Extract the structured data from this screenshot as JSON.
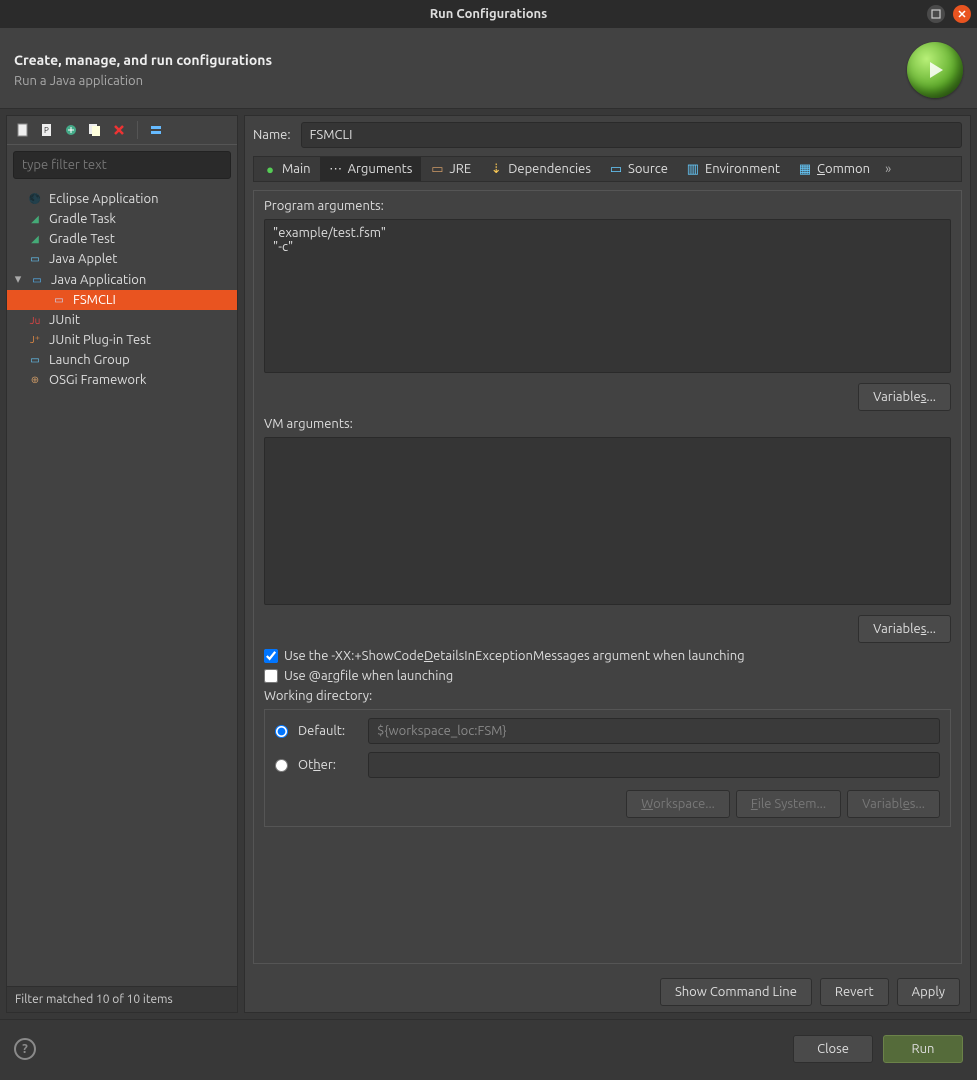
{
  "window": {
    "title": "Run Configurations"
  },
  "header": {
    "title": "Create, manage, and run configurations",
    "subtitle": "Run a Java application"
  },
  "sidebar": {
    "filter_placeholder": "type filter text",
    "items": [
      {
        "label": "Eclipse Application"
      },
      {
        "label": "Gradle Task"
      },
      {
        "label": "Gradle Test"
      },
      {
        "label": "Java Applet"
      },
      {
        "label": "Java Application",
        "expandable": true,
        "expanded": true,
        "children": [
          {
            "label": "FSMCLI",
            "selected": true
          }
        ]
      },
      {
        "label": "JUnit"
      },
      {
        "label": "JUnit Plug-in Test"
      },
      {
        "label": "Launch Group"
      },
      {
        "label": "OSGi Framework"
      }
    ],
    "filter_status": "Filter matched 10 of 10 items"
  },
  "form": {
    "name_label": "Name:",
    "name_value": "FSMCLI",
    "tabs": [
      {
        "label": "Main"
      },
      {
        "label": "Arguments",
        "active": true
      },
      {
        "label": "JRE"
      },
      {
        "label": "Dependencies"
      },
      {
        "label": "Source"
      },
      {
        "label": "Environment"
      },
      {
        "label": "Common"
      }
    ],
    "program_args_label": "Program arguments:",
    "program_args_value": "\"example/test.fsm\"\n\"-c\"",
    "variables_label": "Variables...",
    "vm_args_label": "VM arguments:",
    "vm_args_value": "",
    "check_xx": {
      "label": "Use the -XX:+ShowCodeDetailsInExceptionMessages argument when launching",
      "checked": true
    },
    "check_argfile": {
      "label": "Use @argfile when launching",
      "checked": false
    },
    "workdir_label": "Working directory:",
    "workdir_default_label": "Default:",
    "workdir_default_value": "${workspace_loc:FSM}",
    "workdir_other_label": "Other:",
    "workdir_other_value": "",
    "workspace_btn": "Workspace...",
    "filesystem_btn": "File System...",
    "show_cmd": "Show Command Line",
    "revert": "Revert",
    "apply": "Apply"
  },
  "footer": {
    "close": "Close",
    "run": "Run"
  }
}
